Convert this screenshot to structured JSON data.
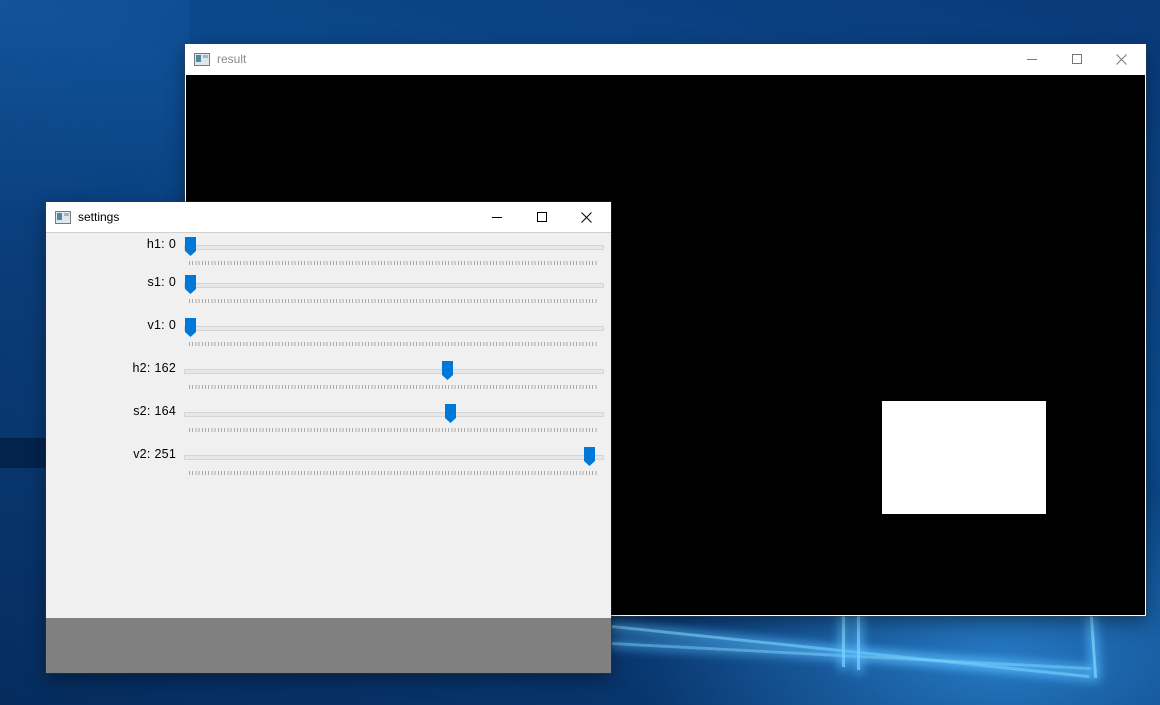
{
  "result_window": {
    "title": "result"
  },
  "settings_window": {
    "title": "settings",
    "trackbars": [
      {
        "name": "h1",
        "value": 0,
        "max": 179,
        "value_text": "0"
      },
      {
        "name": "s1",
        "value": 0,
        "max": 255,
        "value_text": "0"
      },
      {
        "name": "v1",
        "value": 0,
        "max": 255,
        "value_text": "0"
      },
      {
        "name": "h2",
        "value": 162,
        "max": 255,
        "value_text": "162"
      },
      {
        "name": "s2",
        "value": 164,
        "max": 255,
        "value_text": "164"
      },
      {
        "name": "v2",
        "value": 251,
        "max": 255,
        "value_text": "251"
      }
    ]
  },
  "colors": {
    "thumb": "#0078d7",
    "result_background": "#000000",
    "mask_foreground": "#ffffff"
  },
  "icons": {
    "minimize": "minimize-icon",
    "maximize": "maximize-icon",
    "close": "close-icon",
    "app": "app-window-icon"
  }
}
